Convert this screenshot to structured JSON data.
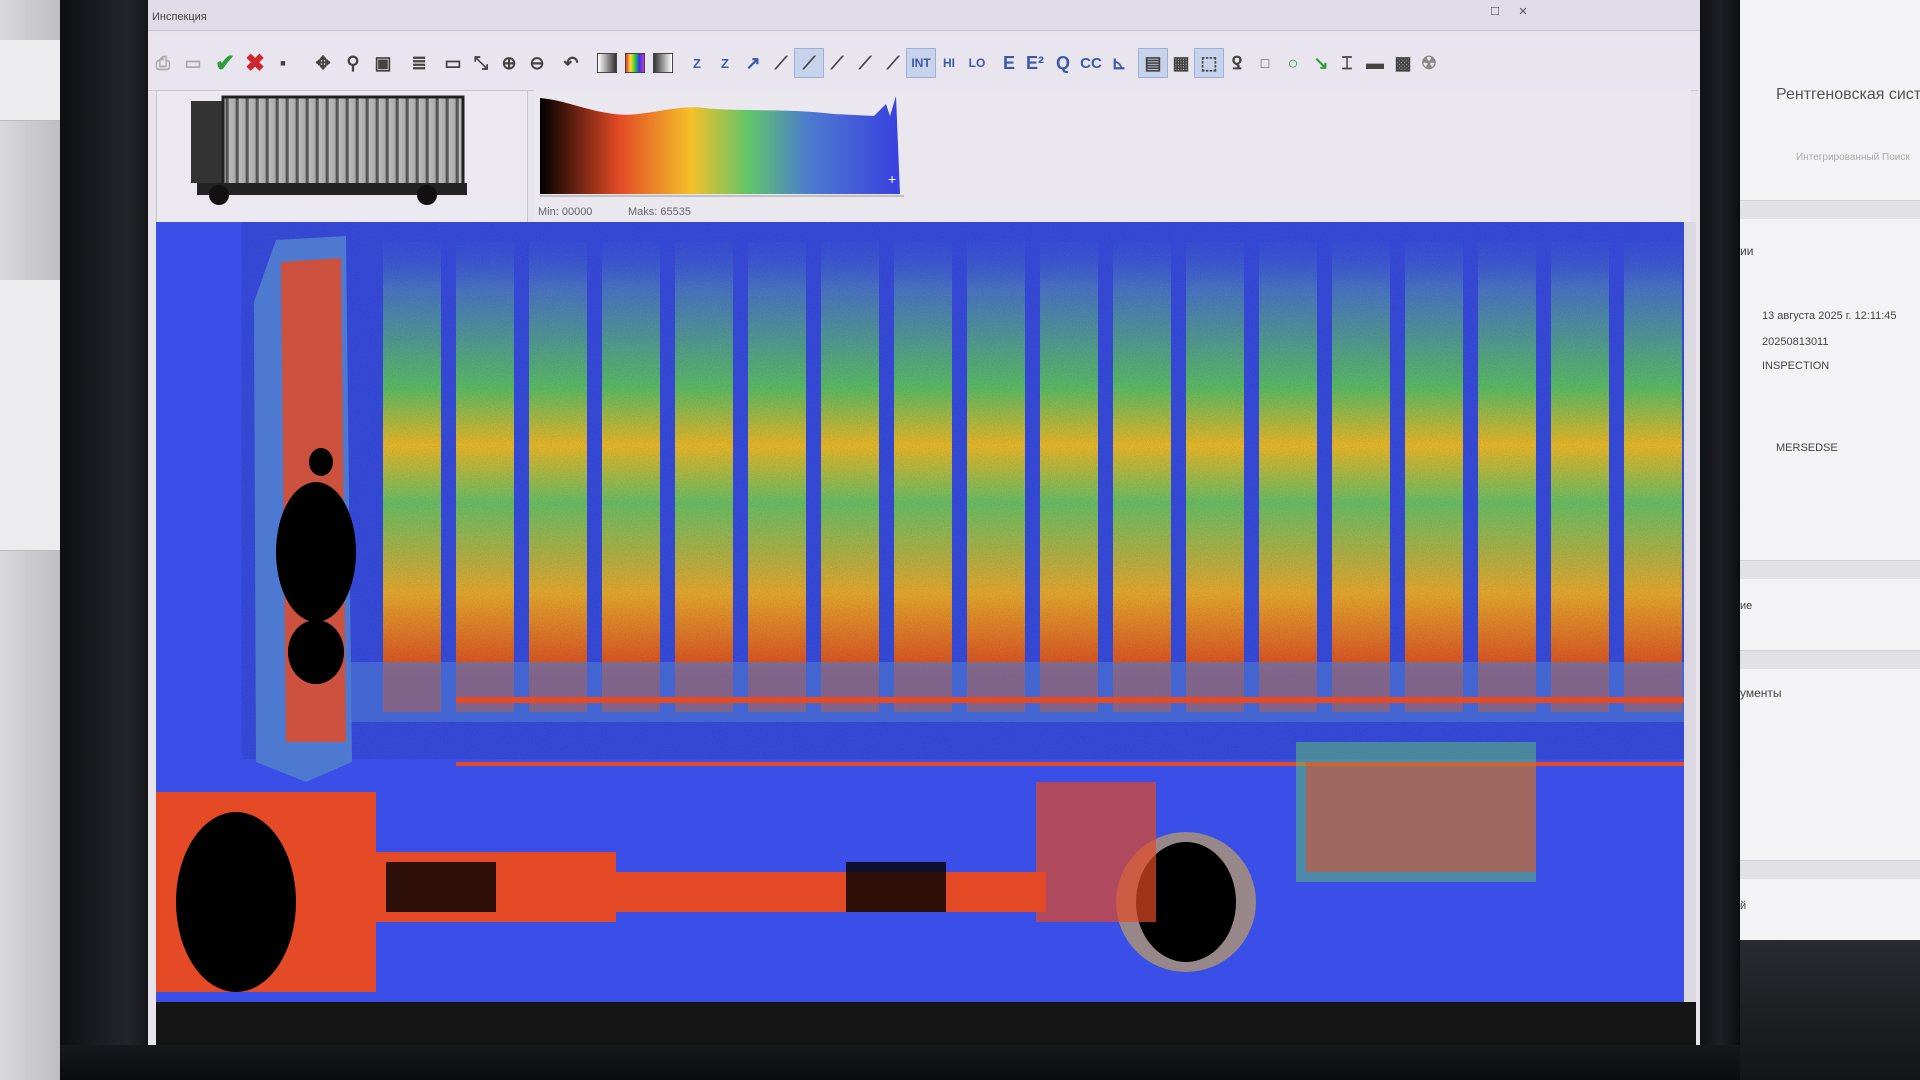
{
  "window": {
    "title": "Инспекция"
  },
  "toolbar": {
    "text_buttons": {
      "z": "Z",
      "z2": "Z",
      "int": "INT",
      "hi": "HI",
      "lo": "LO",
      "e": "E",
      "e2": "E²",
      "q": "Q",
      "cc": "CC"
    }
  },
  "histogram": {
    "min_label": "Min: 00000",
    "max_label": "Maks: 65535",
    "palette": [
      "#000000",
      "#e34a25",
      "#f4c02a",
      "#5fc56a",
      "#4d7ad0",
      "#3940e0"
    ]
  },
  "right_monitor": {
    "app_title": "Рентгеновская сист",
    "app_subtitle": "Интегрированный Поиск",
    "section_fragment": "ии",
    "datetime": "13 августа 2025 г. 12:11:45",
    "scan_id": "20250813011",
    "mode": "INSPECTION",
    "vehicle": "MERSEDSE",
    "fragment_2": "ие",
    "fragment_3": "ументы",
    "fragment_4": "й"
  },
  "colors": {
    "scan_background": "#3a4fe8",
    "accept_icon": "#2e9d3c",
    "reject_icon": "#d0252a",
    "toolbar_text": "#3c5aa8"
  }
}
